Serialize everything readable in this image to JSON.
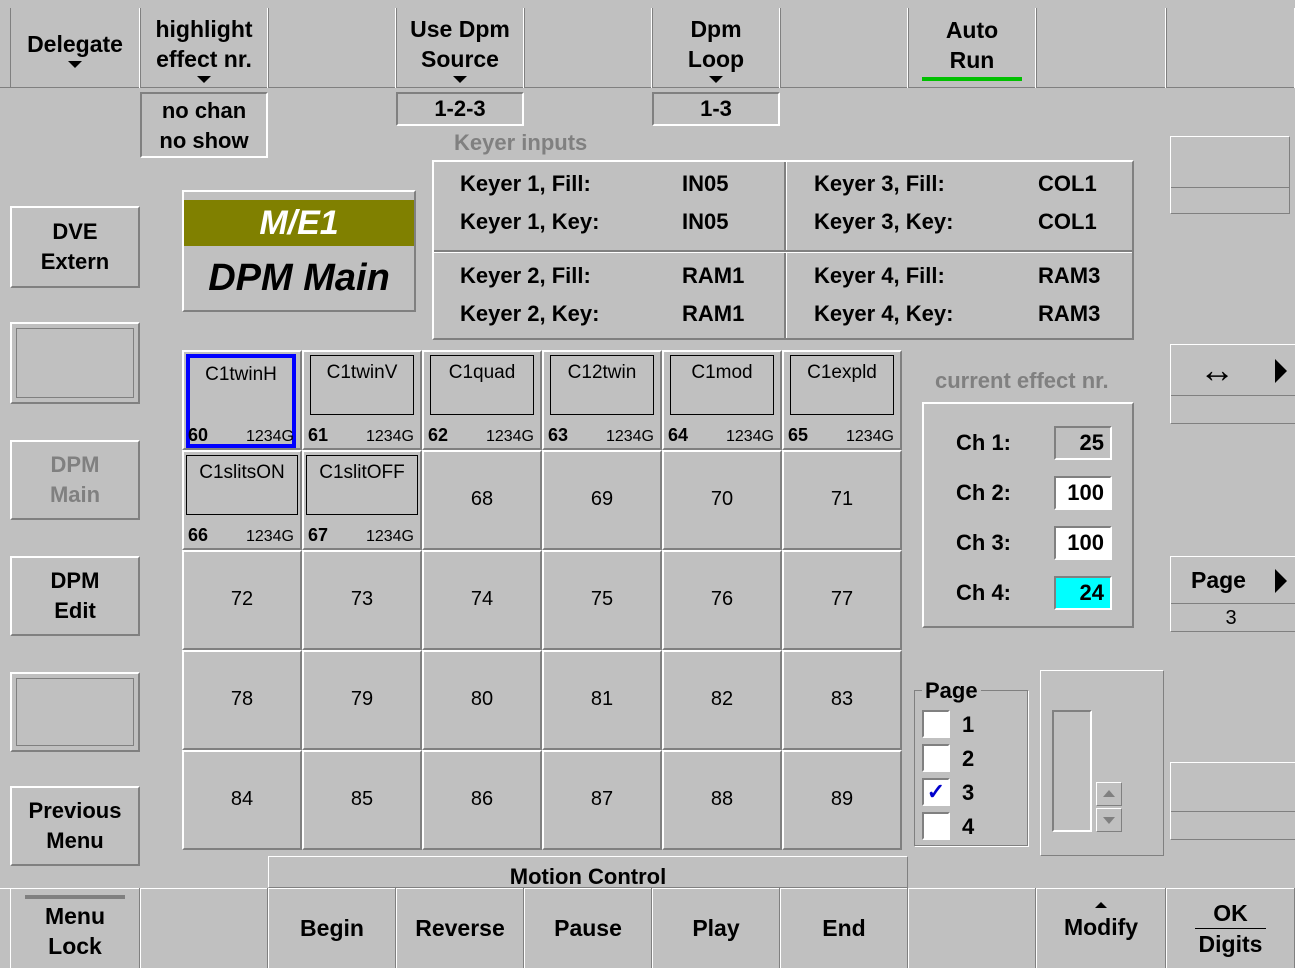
{
  "top_bar": {
    "delegate": "Delegate",
    "highlight_line1": "highlight",
    "highlight_line2": "effect nr.",
    "use_dpm_line1": "Use Dpm",
    "use_dpm_line2": "Source",
    "dpm_loop_line1": "Dpm",
    "dpm_loop_line2": "Loop",
    "auto_run_line1": "Auto",
    "auto_run_line2": "Run",
    "auto_run_indicator_color": "#00c000"
  },
  "status": {
    "highlight_line1": "no chan",
    "highlight_line2": "no show",
    "source_value": "1-2-3",
    "loop_value": "1-3"
  },
  "side_menu": {
    "dve_line1": "DVE",
    "dve_line2": "Extern",
    "dpm_main_line1": "DPM",
    "dpm_main_line2": "Main",
    "dpm_edit_line1": "DPM",
    "dpm_edit_line2": "Edit",
    "prev_line1": "Previous",
    "prev_line2": "Menu"
  },
  "title": {
    "me": "M/E1",
    "main": "DPM Main",
    "me_bg_color": "#808000"
  },
  "keyer": {
    "heading": "Keyer inputs",
    "rows": [
      {
        "label": "Keyer 1, Fill:",
        "value": "IN05"
      },
      {
        "label": "Keyer 1, Key:",
        "value": "IN05"
      },
      {
        "label": "Keyer 3, Fill:",
        "value": "COL1"
      },
      {
        "label": "Keyer 3, Key:",
        "value": "COL1"
      },
      {
        "label": "Keyer 2, Fill:",
        "value": "RAM1"
      },
      {
        "label": "Keyer 2, Key:",
        "value": "RAM1"
      },
      {
        "label": "Keyer 4, Fill:",
        "value": "RAM3"
      },
      {
        "label": "Keyer 4, Key:",
        "value": "RAM3"
      }
    ]
  },
  "effects": {
    "thumb_tiles": [
      {
        "name": "C1twinH",
        "idx": "60",
        "bits": "1234G"
      },
      {
        "name": "C1twinV",
        "idx": "61",
        "bits": "1234G"
      },
      {
        "name": "C1quad",
        "idx": "62",
        "bits": "1234G"
      },
      {
        "name": "C12twin",
        "idx": "63",
        "bits": "1234G"
      },
      {
        "name": "C1mod",
        "idx": "64",
        "bits": "1234G"
      },
      {
        "name": "C1expld",
        "idx": "65",
        "bits": "1234G"
      },
      {
        "name": "C1slitsON",
        "idx": "66",
        "bits": "1234G"
      },
      {
        "name": "C1slitOFF",
        "idx": "67",
        "bits": "1234G"
      }
    ],
    "empty_tiles": [
      "68",
      "69",
      "70",
      "71",
      "72",
      "73",
      "74",
      "75",
      "76",
      "77",
      "78",
      "79",
      "80",
      "81",
      "82",
      "83",
      "84",
      "85",
      "86",
      "87",
      "88",
      "89"
    ],
    "selected_border_color": "#0000ff"
  },
  "current_effect": {
    "heading": "current effect nr.",
    "ch1_label": "Ch 1:",
    "ch1_value": "25",
    "ch2_label": "Ch 2:",
    "ch2_value": "100",
    "ch3_label": "Ch 3:",
    "ch3_value": "100",
    "ch4_label": "Ch 4:",
    "ch4_value": "24",
    "ch4_highlight_color": "#00ffff"
  },
  "right_panel": {
    "arrow_label": "↔",
    "page_label": "Page",
    "page_value": "3"
  },
  "page_select": {
    "heading": "Page",
    "items": [
      {
        "label": "1",
        "checked": false
      },
      {
        "label": "2",
        "checked": false
      },
      {
        "label": "3",
        "checked": true
      },
      {
        "label": "4",
        "checked": false
      }
    ]
  },
  "motion_control": {
    "heading": "Motion Control"
  },
  "bottom_bar": {
    "menu_lock_line1": "Menu",
    "menu_lock_line2": "Lock",
    "begin": "Begin",
    "reverse": "Reverse",
    "pause": "Pause",
    "play": "Play",
    "end": "End",
    "modify": "Modify",
    "ok_line1": "OK",
    "ok_line2": "Digits"
  }
}
